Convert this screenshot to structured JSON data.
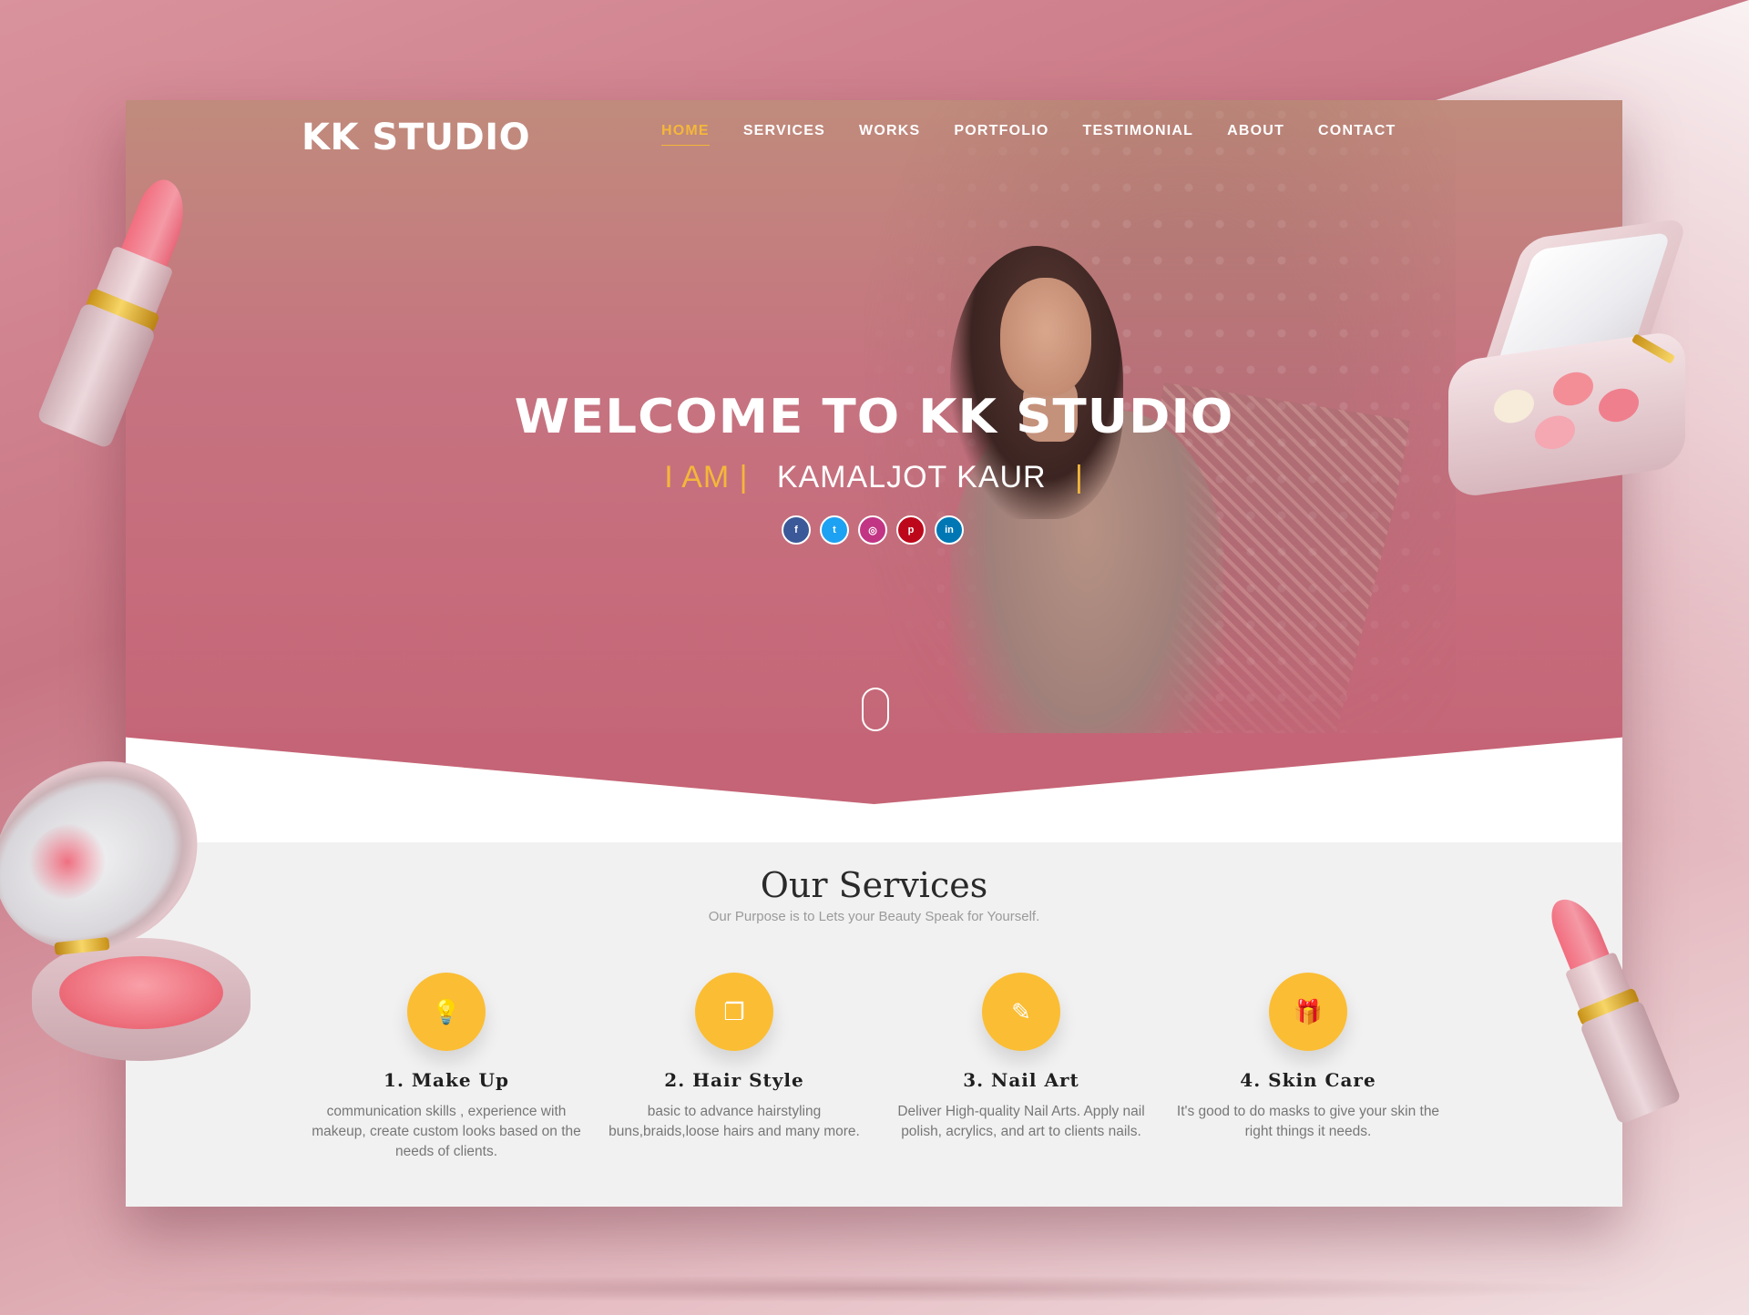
{
  "brand": {
    "logo": "KK STUDIO"
  },
  "nav": {
    "items": [
      {
        "label": "HOME",
        "active": true
      },
      {
        "label": "SERVICES",
        "active": false
      },
      {
        "label": "WORKS",
        "active": false
      },
      {
        "label": "PORTFOLIO",
        "active": false
      },
      {
        "label": "TESTIMONIAL",
        "active": false
      },
      {
        "label": "ABOUT",
        "active": false
      },
      {
        "label": "CONTACT",
        "active": false
      }
    ]
  },
  "hero": {
    "title": "WELCOME TO KK STUDIO",
    "sub_prefix": "I AM |",
    "sub_name": "KAMALJOT KAUR",
    "sub_cursor": "|",
    "socials": [
      {
        "icon": "facebook-icon",
        "glyph": "f",
        "color": "#3b5998"
      },
      {
        "icon": "twitter-icon",
        "glyph": "t",
        "color": "#1da1f2"
      },
      {
        "icon": "instagram-icon",
        "glyph": "◎",
        "color": "#c13584"
      },
      {
        "icon": "pinterest-icon",
        "glyph": "p",
        "color": "#bd081c"
      },
      {
        "icon": "linkedin-icon",
        "glyph": "in",
        "color": "#0077b5"
      }
    ]
  },
  "services": {
    "title": "Our Services",
    "subtitle": "Our Purpose is to Lets your Beauty Speak for Yourself.",
    "items": [
      {
        "icon": "lightbulb-icon",
        "glyph": "💡",
        "title": "1. Make Up",
        "desc": "communication skills , experience with makeup, create custom looks based on the needs of clients."
      },
      {
        "icon": "files-icon",
        "glyph": "❐",
        "title": "2. Hair Style",
        "desc": "basic to advance hairstyling buns,braids,loose hairs and many more."
      },
      {
        "icon": "brush-icon",
        "glyph": "✎",
        "title": "3. Nail Art",
        "desc": "Deliver High-quality Nail Arts. Apply nail polish, acrylics, and art to clients nails."
      },
      {
        "icon": "gift-icon",
        "glyph": "🎁",
        "title": "4. Skin Care",
        "desc": "It's good to do masks to give your skin the right things it needs."
      }
    ]
  },
  "colors": {
    "accent": "#f4b73a",
    "icon_circle": "#fbbd33",
    "hero_bottom": "#c56476"
  }
}
